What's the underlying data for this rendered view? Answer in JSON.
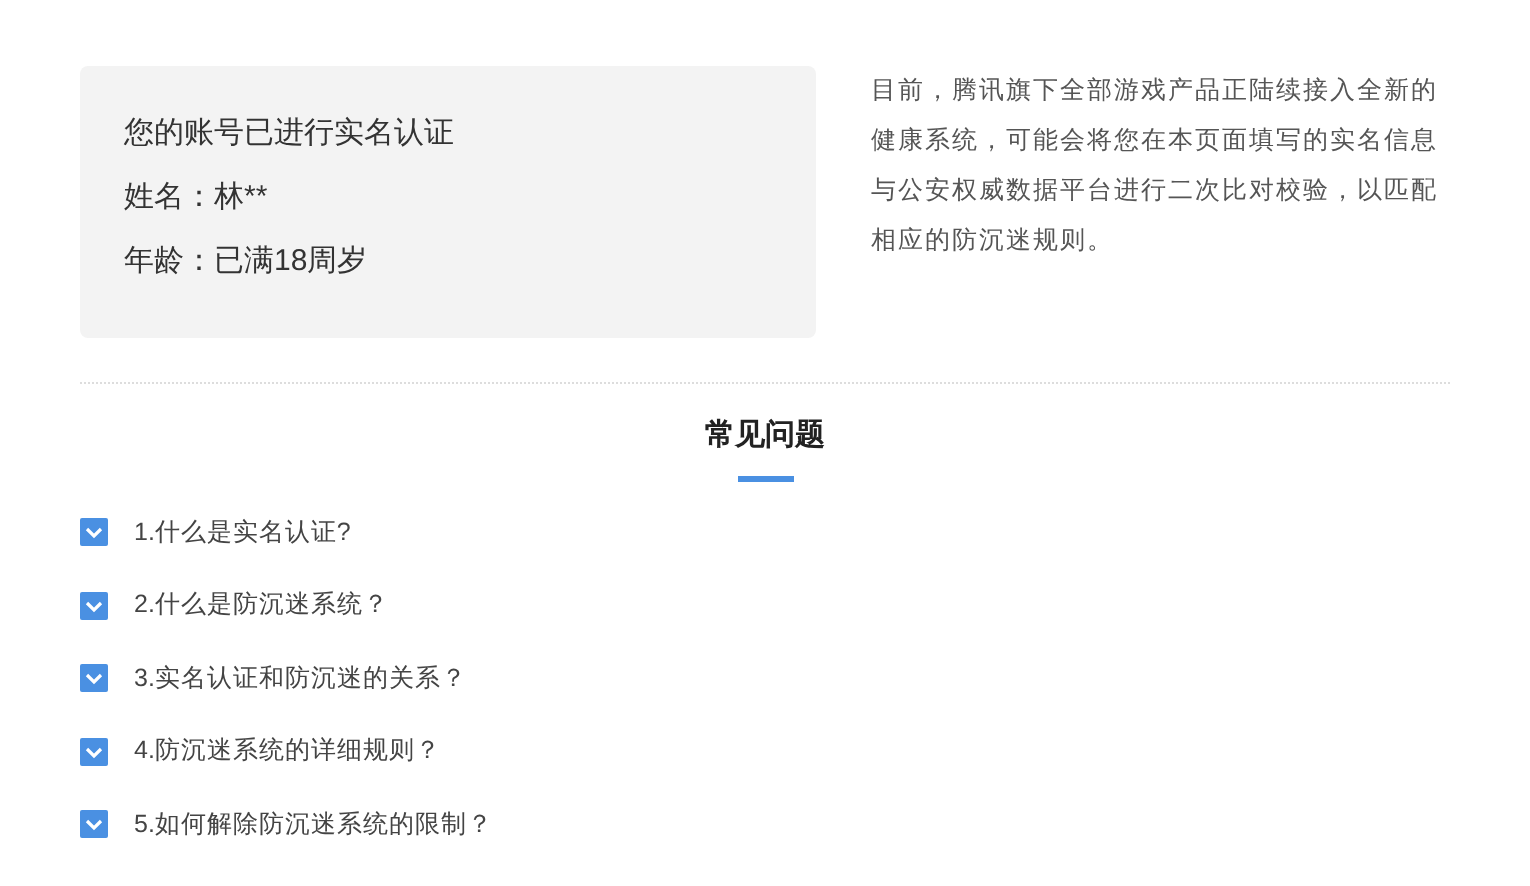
{
  "account_card": {
    "title": "您的账号已进行实名认证",
    "name_line": "姓名：林**",
    "age_line": "年龄：已满18周岁"
  },
  "notice": "目前，腾讯旗下全部游戏产品正陆续接入全新的健康系统，可能会将您在本页面填写的实名信息与公安权威数据平台进行二次比对校验，以匹配相应的防沉迷规则。",
  "faq": {
    "title": "常见问题",
    "items": [
      {
        "label": "1.什么是实名认证?",
        "expanded": false
      },
      {
        "label": "2.什么是防沉迷系统？",
        "expanded": false
      },
      {
        "label": "3.实名认证和防沉迷的关系？",
        "expanded": false
      },
      {
        "label": "4.防沉迷系统的详细规则？",
        "expanded": false
      },
      {
        "label": "5.如何解除防沉迷系统的限制？",
        "expanded": false
      }
    ]
  }
}
